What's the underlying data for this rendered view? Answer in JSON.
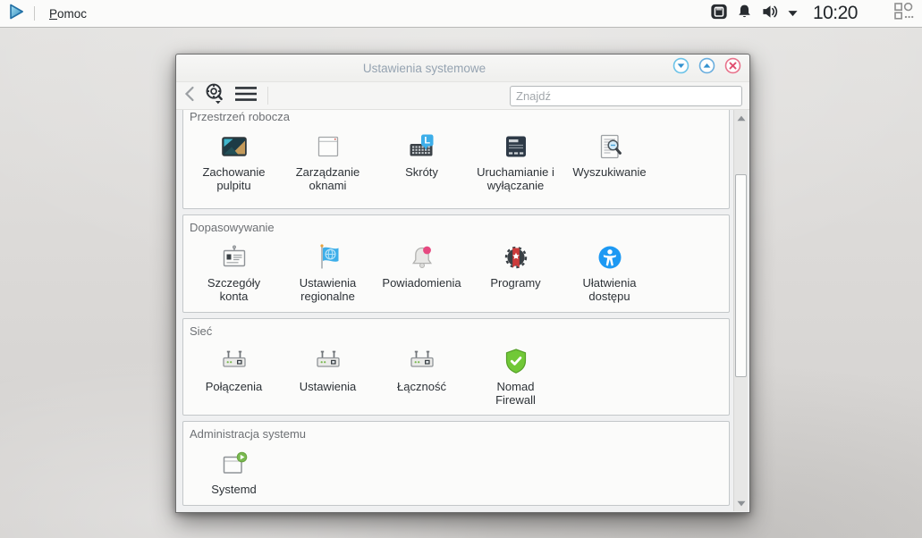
{
  "colors": {
    "accent_blue": "#3daee9",
    "titlebar_button_blue_stroke": "#6cc3e8",
    "titlebar_button_red": "#e14f70",
    "firewall_green": "#71c837",
    "notification_pink": "#e64980",
    "panel_bg": "#fbfbfa",
    "window_bg": "#eff0f1",
    "section_bg": "#fbfbfa",
    "desktop_bg": "#dcdad8"
  },
  "panel": {
    "launcher_icon": "launcher-icon",
    "menu_items": [
      {
        "label": "Pomoc",
        "accel": "P",
        "rest": "omoc"
      }
    ],
    "tray_icons": [
      "media-player-icon",
      "notifications-icon",
      "volume-icon",
      "caret-down-icon"
    ],
    "clock": "10:20",
    "widgets_icon": "widgets-icon"
  },
  "window": {
    "title": "Ustawienia systemowe",
    "titlebar_buttons": [
      "minimize",
      "maximize",
      "close"
    ],
    "toolbar": {
      "back_icon": "back-icon",
      "overview_icon": "overview-icon",
      "menu_icon": "menu-icon",
      "search_placeholder": "Znajdź"
    },
    "sections": [
      {
        "label": "Przestrzeń robocza",
        "clipped": true,
        "items": [
          {
            "label": "Zachowanie\npulpitu",
            "icon": "desktop-behavior-icon"
          },
          {
            "label": "Zarządzanie\noknami",
            "icon": "window-management-icon"
          },
          {
            "label": "Skróty",
            "icon": "shortcuts-icon"
          },
          {
            "label": "Uruchamianie i\nwyłączanie",
            "icon": "startup-shutdown-icon"
          },
          {
            "label": "Wyszukiwanie",
            "icon": "search-doc-icon"
          }
        ]
      },
      {
        "label": "Dopasowywanie",
        "clipped": false,
        "items": [
          {
            "label": "Szczegóły\nkonta",
            "icon": "account-details-icon"
          },
          {
            "label": "Ustawienia\nregionalne",
            "icon": "regional-settings-icon"
          },
          {
            "label": "Powiadomienia",
            "icon": "notifications-module-icon"
          },
          {
            "label": "Programy",
            "icon": "applications-icon"
          },
          {
            "label": "Ułatwienia\ndostępu",
            "icon": "accessibility-icon"
          }
        ]
      },
      {
        "label": "Sieć",
        "clipped": false,
        "items": [
          {
            "label": "Połączenia",
            "icon": "router-icon"
          },
          {
            "label": "Ustawienia",
            "icon": "router-icon"
          },
          {
            "label": "Łączność",
            "icon": "router-icon"
          },
          {
            "label": "Nomad\nFirewall",
            "icon": "firewall-icon"
          }
        ]
      },
      {
        "label": "Administracja systemu",
        "clipped": false,
        "items": [
          {
            "label": "Systemd",
            "icon": "systemd-icon"
          }
        ]
      }
    ]
  }
}
